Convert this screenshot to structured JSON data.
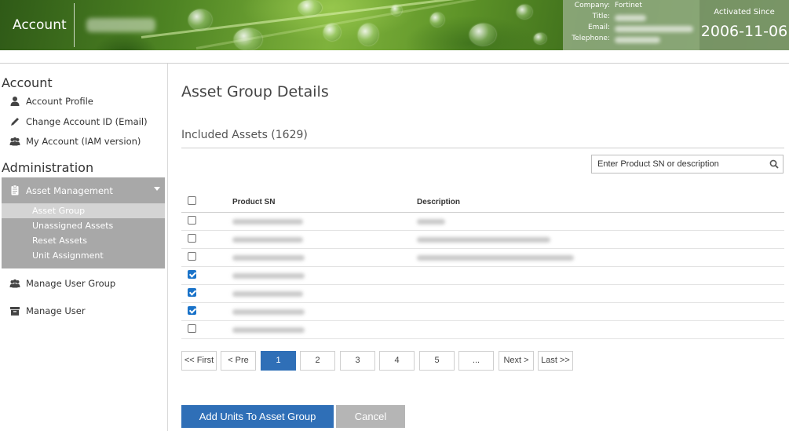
{
  "header": {
    "title": "Account",
    "info": {
      "company_label": "Company:",
      "company_value": "Fortinet",
      "title_label": "Title:",
      "email_label": "Email:",
      "telephone_label": "Telephone:"
    },
    "activated_label": "Activated Since",
    "activated_date": "2006-11-06"
  },
  "sidebar": {
    "account_title": "Account",
    "account_items": [
      {
        "label": "Account Profile",
        "icon": "user-icon"
      },
      {
        "label": "Change Account ID (Email)",
        "icon": "pencil-icon"
      },
      {
        "label": "My Account (IAM version)",
        "icon": "users-icon"
      }
    ],
    "admin_title": "Administration",
    "asset_management": {
      "label": "Asset Management",
      "icon": "clipboard-icon",
      "items": [
        {
          "label": "Asset Group",
          "active": true
        },
        {
          "label": "Unassigned Assets",
          "active": false
        },
        {
          "label": "Reset Assets",
          "active": false
        },
        {
          "label": "Unit Assignment",
          "active": false
        }
      ]
    },
    "manage_user_group": {
      "label": "Manage User Group",
      "icon": "users-icon"
    },
    "manage_user": {
      "label": "Manage User",
      "icon": "archive-icon"
    }
  },
  "main": {
    "page_title": "Asset Group Details",
    "included_label": "Included Assets (1629)",
    "search_placeholder": "Enter Product SN or description",
    "table": {
      "columns": [
        "Product SN",
        "Description"
      ],
      "rows": [
        {
          "checked": false
        },
        {
          "checked": false
        },
        {
          "checked": false
        },
        {
          "checked": true
        },
        {
          "checked": true
        },
        {
          "checked": true
        },
        {
          "checked": false
        }
      ]
    },
    "pagination": [
      "<< First",
      "< Pre",
      "1",
      "2",
      "3",
      "4",
      "5",
      "...",
      "Next >",
      "Last >>"
    ],
    "current_page": "1",
    "add_button": "Add Units To Asset Group",
    "cancel_button": "Cancel"
  },
  "colors": {
    "primary": "#2f6fb7",
    "sidebar_active_bg": "#a8a8a8",
    "cancel_bg": "#b5b5b5",
    "checkbox_checked": "#1a73c9"
  }
}
